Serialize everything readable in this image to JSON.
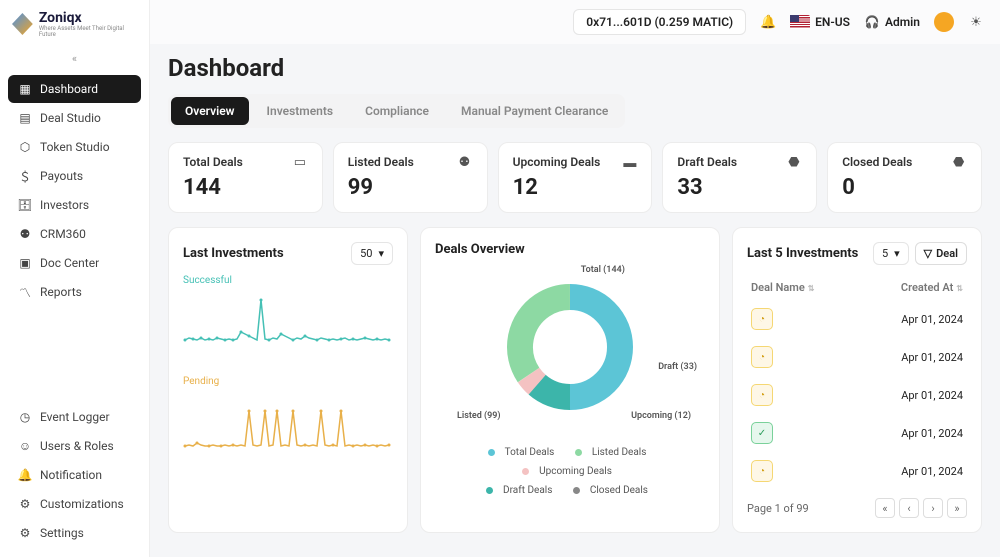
{
  "brand": {
    "name": "Zoniqx",
    "tagline": "Where Assets Meet Their Digital Future"
  },
  "topbar": {
    "wallet": "0x71...601D (0.259 MATIC)",
    "locale": "EN-US",
    "role": "Admin"
  },
  "nav": {
    "items": [
      {
        "label": "Dashboard",
        "icon": "grid"
      },
      {
        "label": "Deal Studio",
        "icon": "layers"
      },
      {
        "label": "Token Studio",
        "icon": "hex"
      },
      {
        "label": "Payouts",
        "icon": "cash"
      },
      {
        "label": "Investors",
        "icon": "brief"
      },
      {
        "label": "CRM360",
        "icon": "people"
      },
      {
        "label": "Doc Center",
        "icon": "doc"
      },
      {
        "label": "Reports",
        "icon": "chart"
      }
    ],
    "bottom": [
      {
        "label": "Event Logger",
        "icon": "clock"
      },
      {
        "label": "Users & Roles",
        "icon": "user"
      },
      {
        "label": "Notification",
        "icon": "bell"
      },
      {
        "label": "Customizations",
        "icon": "sliders"
      },
      {
        "label": "Settings",
        "icon": "gear"
      }
    ]
  },
  "page": {
    "title": "Dashboard"
  },
  "tabs": [
    "Overview",
    "Investments",
    "Compliance",
    "Manual Payment Clearance"
  ],
  "stats": [
    {
      "label": "Total Deals",
      "value": "144",
      "icon": "id"
    },
    {
      "label": "Listed Deals",
      "value": "99",
      "icon": "people"
    },
    {
      "label": "Upcoming Deals",
      "value": "12",
      "icon": "card"
    },
    {
      "label": "Draft Deals",
      "value": "33",
      "icon": "box"
    },
    {
      "label": "Closed Deals",
      "value": "0",
      "icon": "box"
    }
  ],
  "lastInvestments": {
    "title": "Last Investments",
    "limit": "50",
    "series": [
      {
        "name": "Successful",
        "color": "#45c0b5"
      },
      {
        "name": "Pending",
        "color": "#e8b04a"
      }
    ]
  },
  "dealsOverview": {
    "title": "Deals Overview",
    "labels": {
      "total": "Total (144)",
      "draft": "Draft (33)",
      "upcoming": "Upcoming (12)",
      "listed": "Listed (99)"
    },
    "legend": [
      "Total Deals",
      "Listed Deals",
      "Upcoming Deals",
      "Draft Deals",
      "Closed Deals"
    ]
  },
  "last5": {
    "title": "Last 5 Investments",
    "limit": "5",
    "buttonLabel": "Deal",
    "columns": [
      "Deal Name",
      "Created At"
    ],
    "rows": [
      {
        "status": "y",
        "date": "Apr 01, 2024"
      },
      {
        "status": "y",
        "date": "Apr 01, 2024"
      },
      {
        "status": "y",
        "date": "Apr 01, 2024"
      },
      {
        "status": "g",
        "date": "Apr 01, 2024"
      },
      {
        "status": "y",
        "date": "Apr 01, 2024"
      }
    ],
    "pager": "Page 1 of 99"
  },
  "chart_data": [
    {
      "type": "line",
      "title": "Last Investments",
      "series": [
        {
          "name": "Successful",
          "values": [
            10,
            12,
            11,
            10,
            12,
            10,
            11,
            10,
            12,
            11,
            10,
            11,
            10,
            11,
            15,
            14,
            13,
            12,
            10,
            30,
            11,
            10,
            12,
            11,
            14,
            13,
            12,
            10,
            12,
            11,
            13,
            12,
            11,
            10,
            12,
            11,
            10,
            11,
            10,
            11,
            12,
            10,
            11,
            10,
            11,
            12,
            11,
            10,
            11,
            10
          ]
        },
        {
          "name": "Pending",
          "values": [
            5,
            6,
            5,
            7,
            6,
            5,
            5,
            6,
            5,
            5,
            6,
            5,
            6,
            5,
            6,
            5,
            20,
            6,
            5,
            6,
            20,
            5,
            6,
            20,
            5,
            6,
            5,
            20,
            6,
            5,
            6,
            5,
            6,
            5,
            20,
            6,
            5,
            6,
            5,
            20,
            5,
            6,
            5,
            6,
            5,
            6,
            5,
            6,
            5,
            6
          ]
        }
      ],
      "xlabel": "",
      "ylabel": "",
      "ylim": [
        0,
        35
      ]
    },
    {
      "type": "pie",
      "title": "Deals Overview",
      "categories": [
        "Total Deals",
        "Listed Deals",
        "Upcoming Deals",
        "Draft Deals",
        "Closed Deals"
      ],
      "values": [
        144,
        99,
        12,
        33,
        0
      ],
      "colors": [
        "#5cc5d6",
        "#8dd9a3",
        "#f4c2c2",
        "#3cb5aa",
        "#888888"
      ]
    }
  ]
}
